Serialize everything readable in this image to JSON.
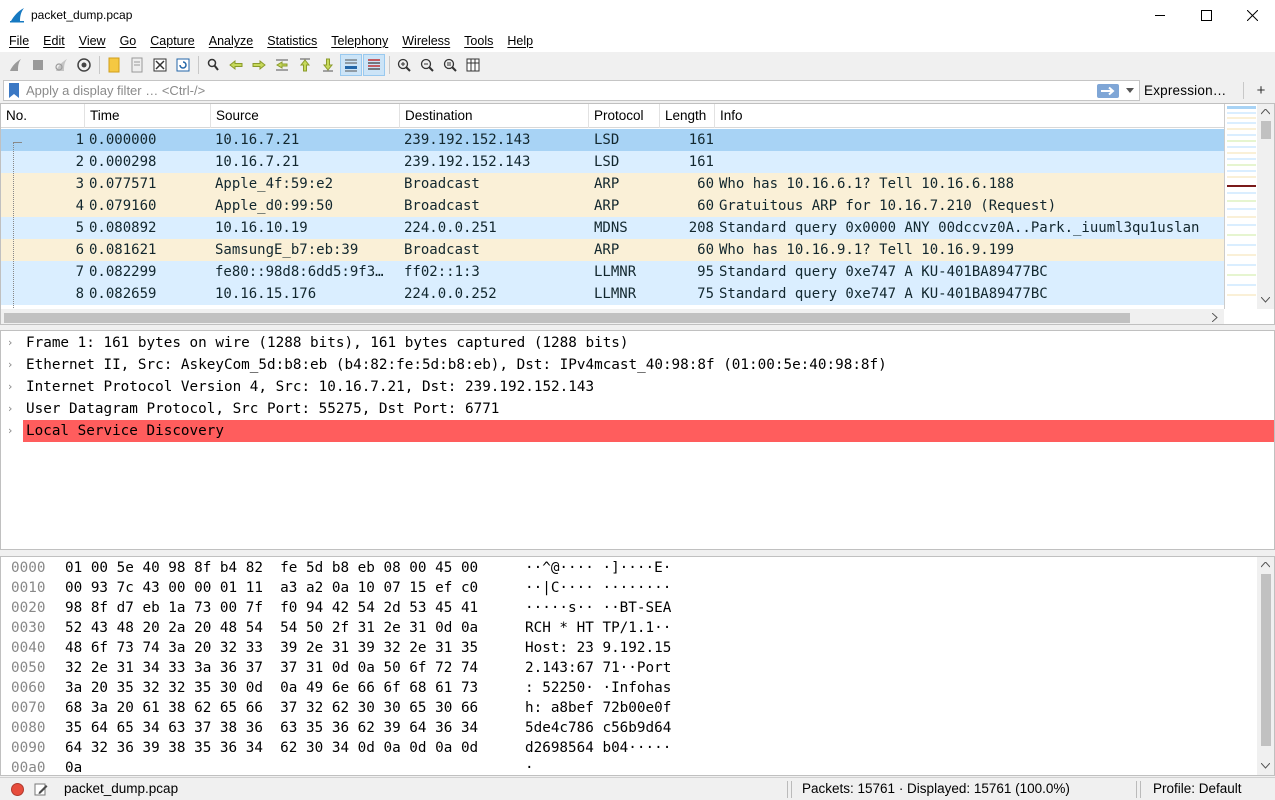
{
  "window": {
    "title": "packet_dump.pcap",
    "controls": [
      "minimize-icon",
      "maximize-icon",
      "close-icon"
    ]
  },
  "menu": [
    "File",
    "Edit",
    "View",
    "Go",
    "Capture",
    "Analyze",
    "Statistics",
    "Telephony",
    "Wireless",
    "Tools",
    "Help"
  ],
  "toolbar_icons": [
    "start-capture-icon",
    "stop-capture-icon",
    "restart-capture-icon",
    "capture-options-icon",
    "open-file-icon",
    "save-file-icon",
    "close-file-icon",
    "reload-file-icon",
    "find-packet-icon",
    "go-back-icon",
    "go-forward-icon",
    "go-to-packet-icon",
    "go-first-icon",
    "go-last-icon",
    "autoscroll-icon",
    "colorize-icon",
    "zoom-in-icon",
    "zoom-out-icon",
    "zoom-normal-icon",
    "resize-columns-icon"
  ],
  "filter": {
    "placeholder": "Apply a display filter … <Ctrl-/>",
    "expression_label": "Expression…",
    "add_label": "+"
  },
  "packet_list": {
    "columns": [
      "No.",
      "Time",
      "Source",
      "Destination",
      "Protocol",
      "Length",
      "Info"
    ],
    "rows": [
      {
        "no": "1",
        "time": "0.000000",
        "source": "10.16.7.21",
        "destination": "239.192.152.143",
        "protocol": "LSD",
        "length": "161",
        "info": ""
      },
      {
        "no": "2",
        "time": "0.000298",
        "source": "10.16.7.21",
        "destination": "239.192.152.143",
        "protocol": "LSD",
        "length": "161",
        "info": ""
      },
      {
        "no": "3",
        "time": "0.077571",
        "source": "Apple_4f:59:e2",
        "destination": "Broadcast",
        "protocol": "ARP",
        "length": "60",
        "info": "Who has 10.16.6.1? Tell 10.16.6.188"
      },
      {
        "no": "4",
        "time": "0.079160",
        "source": "Apple_d0:99:50",
        "destination": "Broadcast",
        "protocol": "ARP",
        "length": "60",
        "info": "Gratuitous ARP for 10.16.7.210 (Request)"
      },
      {
        "no": "5",
        "time": "0.080892",
        "source": "10.16.10.19",
        "destination": "224.0.0.251",
        "protocol": "MDNS",
        "length": "208",
        "info": "Standard query 0x0000 ANY 00dccvz0A..Park._iuuml3qu1uslan"
      },
      {
        "no": "6",
        "time": "0.081621",
        "source": "SamsungE_b7:eb:39",
        "destination": "Broadcast",
        "protocol": "ARP",
        "length": "60",
        "info": "Who has 10.16.9.1? Tell 10.16.9.199"
      },
      {
        "no": "7",
        "time": "0.082299",
        "source": "fe80::98d8:6dd5:9f3…",
        "destination": "ff02::1:3",
        "protocol": "LLMNR",
        "length": "95",
        "info": "Standard query 0xe747 A KU-401BA89477BC"
      },
      {
        "no": "8",
        "time": "0.082659",
        "source": "10.16.15.176",
        "destination": "224.0.0.252",
        "protocol": "LLMNR",
        "length": "75",
        "info": "Standard query 0xe747 A KU-401BA89477BC"
      }
    ],
    "row_colors": {
      "selected": "#a8d3f5",
      "udp": "#daeeff",
      "arp": "#faf0d7"
    }
  },
  "details": [
    {
      "text": "Frame 1: 161 bytes on wire (1288 bits), 161 bytes captured (1288 bits)",
      "selected": false
    },
    {
      "text": "Ethernet II, Src: AskeyCom_5d:b8:eb (b4:82:fe:5d:b8:eb), Dst: IPv4mcast_40:98:8f (01:00:5e:40:98:8f)",
      "selected": false
    },
    {
      "text": "Internet Protocol Version 4, Src: 10.16.7.21, Dst: 239.192.152.143",
      "selected": false
    },
    {
      "text": "User Datagram Protocol, Src Port: 55275, Dst Port: 6771",
      "selected": false
    },
    {
      "text": "Local Service Discovery",
      "selected": true
    }
  ],
  "details_highlight_color": "#ff5d5d",
  "bytes": [
    {
      "offset": "0000",
      "hex": "01 00 5e 40 98 8f b4 82  fe 5d b8 eb 08 00 45 00",
      "ascii": "··^@···· ·]····E·"
    },
    {
      "offset": "0010",
      "hex": "00 93 7c 43 00 00 01 11  a3 a2 0a 10 07 15 ef c0",
      "ascii": "··|C···· ········"
    },
    {
      "offset": "0020",
      "hex": "98 8f d7 eb 1a 73 00 7f  f0 94 42 54 2d 53 45 41",
      "ascii": "·····s·· ··BT-SEA"
    },
    {
      "offset": "0030",
      "hex": "52 43 48 20 2a 20 48 54  54 50 2f 31 2e 31 0d 0a",
      "ascii": "RCH * HT TP/1.1··"
    },
    {
      "offset": "0040",
      "hex": "48 6f 73 74 3a 20 32 33  39 2e 31 39 32 2e 31 35",
      "ascii": "Host: 23 9.192.15"
    },
    {
      "offset": "0050",
      "hex": "32 2e 31 34 33 3a 36 37  37 31 0d 0a 50 6f 72 74",
      "ascii": "2.143:67 71··Port"
    },
    {
      "offset": "0060",
      "hex": "3a 20 35 32 32 35 30 0d  0a 49 6e 66 6f 68 61 73",
      "ascii": ": 52250· ·Infohas"
    },
    {
      "offset": "0070",
      "hex": "68 3a 20 61 38 62 65 66  37 32 62 30 30 65 30 66",
      "ascii": "h: a8bef 72b00e0f"
    },
    {
      "offset": "0080",
      "hex": "35 64 65 34 63 37 38 36  63 35 36 62 39 64 36 34",
      "ascii": "5de4c786 c56b9d64"
    },
    {
      "offset": "0090",
      "hex": "64 32 36 39 38 35 36 34  62 30 34 0d 0a 0d 0a 0d",
      "ascii": "d2698564 b04·····"
    },
    {
      "offset": "00a0",
      "hex": "0a",
      "ascii": "·"
    }
  ],
  "status": {
    "file": "packet_dump.pcap",
    "packets": "Packets: 15761 · Displayed: 15761 (100.0%)",
    "profile": "Profile: Default"
  }
}
